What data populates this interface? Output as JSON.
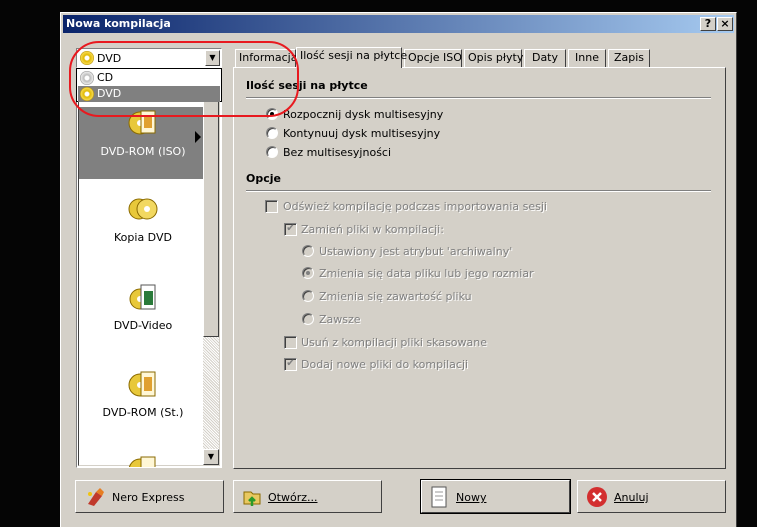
{
  "window": {
    "title": "Nowa kompilacja",
    "help_label": "?",
    "close_label": "×"
  },
  "combo": {
    "selected": "DVD",
    "options": [
      "CD",
      "DVD"
    ]
  },
  "list_items": [
    {
      "label": "DVD-ROM (ISO)",
      "icon": "dvd-rom-iso-icon",
      "selected": true
    },
    {
      "label": "Kopia DVD",
      "icon": "dvd-copy-icon",
      "selected": false
    },
    {
      "label": "DVD-Video",
      "icon": "dvd-video-icon",
      "selected": false
    },
    {
      "label": "DVD-ROM (St.)",
      "icon": "dvd-rom-st-icon",
      "selected": false
    },
    {
      "label": "",
      "icon": "dvd-more-icon",
      "selected": false
    }
  ],
  "tabs": [
    {
      "label": "Informacja",
      "active": false
    },
    {
      "label": "Ilość sesji na płytce",
      "active": true
    },
    {
      "label": "Opcje ISO",
      "active": false
    },
    {
      "label": "Opis płyty",
      "active": false
    },
    {
      "label": "Daty",
      "active": false
    },
    {
      "label": "Inne",
      "active": false
    },
    {
      "label": "Zapis",
      "active": false
    }
  ],
  "sessions": {
    "heading": "Ilość sesji na płytce",
    "options": [
      {
        "label": "Rozpocznij dysk multisesyjny",
        "checked": true
      },
      {
        "label": "Kontynuuj dysk multisesyjny",
        "checked": false
      },
      {
        "label": "Bez multisesyjności",
        "checked": false
      }
    ]
  },
  "options": {
    "heading": "Opcje",
    "refresh": "Odśwież kompilację podczas importowania sesji",
    "replace": "Zamień pliki w kompilacji:",
    "replace_modes": [
      {
        "label": "Ustawiony jest atrybut 'archiwalny'",
        "checked": false
      },
      {
        "label": "Zmienia się data pliku lub jego rozmiar",
        "checked": true
      },
      {
        "label": "Zmienia się zawartość pliku",
        "checked": false
      },
      {
        "label": "Zawsze",
        "checked": false
      }
    ],
    "remove_deleted": "Usuń z kompilacji pliki skasowane",
    "add_new": "Dodaj nowe pliki do kompilacji"
  },
  "buttons": {
    "nero_express": "Nero Express",
    "open": "Otwórz...",
    "new": "Nowy",
    "cancel": "Anuluj"
  },
  "colors": {
    "annotation": "#e8191f",
    "titlebar": "#0a246a"
  }
}
